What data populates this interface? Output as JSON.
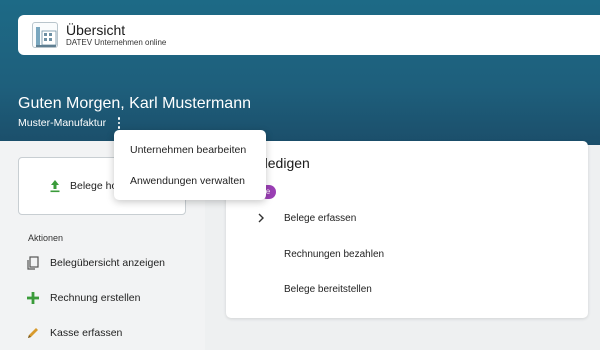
{
  "app": {
    "title": "Übersicht",
    "subtitle": "DATEV Unternehmen online"
  },
  "header": {
    "greeting": "Guten Morgen, Karl Mustermann",
    "company": "Muster-Manufaktur"
  },
  "context_menu": {
    "items": [
      "Unternehmen bearbeiten",
      "Anwendungen verwalten"
    ]
  },
  "upload": {
    "label": "Belege ho"
  },
  "actions": {
    "title": "Aktionen",
    "items": [
      {
        "label": "Belegübersicht anzeigen",
        "icon": "document-copy-icon"
      },
      {
        "label": "Rechnung erstellen",
        "icon": "plus-icon"
      },
      {
        "label": "Kasse erfassen",
        "icon": "pencil-icon"
      }
    ]
  },
  "todo": {
    "title_visible": "rledigen",
    "badge": "e",
    "tasks": [
      "Belege erfassen",
      "Rechnungen bezahlen",
      "Belege bereitstellen"
    ]
  },
  "colors": {
    "header": "#1e5f7c",
    "badge": "#9b3fb5",
    "plus_icon": "#3a9b3a",
    "upload_arrow": "#3a9b3a",
    "pencil": "#d89a2c"
  }
}
